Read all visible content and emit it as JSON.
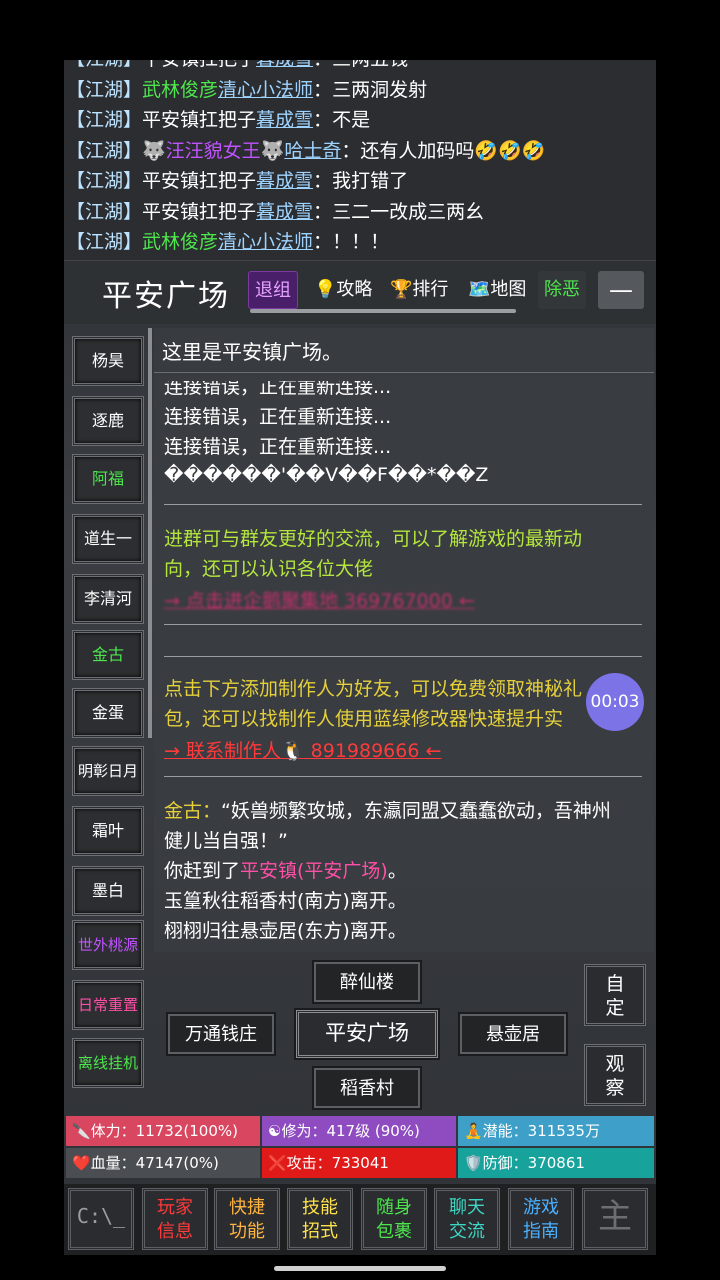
{
  "chat": {
    "lines": [
      {
        "channel": "【江湖】",
        "title": "平安镇扛把子",
        "name": "暮成雪",
        "sep": "：",
        "msg": "三两五钱"
      },
      {
        "channel": "【江湖】",
        "title": "武林俊彦",
        "name": "清心小法师",
        "sep": "：",
        "msg": "三两洞发射"
      },
      {
        "channel": "【江湖】",
        "title": "平安镇扛把子",
        "name": "暮成雪",
        "sep": "：",
        "msg": "不是"
      },
      {
        "channel": "【江湖】",
        "title": "🐺汪汪貌女王🐺",
        "name": "哈士奇",
        "sep": "：",
        "msg": "还有人加码吗",
        "emoji": "🤣🤣🤣"
      },
      {
        "channel": "【江湖】",
        "title": "平安镇扛把子",
        "name": "暮成雪",
        "sep": "：",
        "msg": "我打错了"
      },
      {
        "channel": "【江湖】",
        "title": "平安镇扛把子",
        "name": "暮成雪",
        "sep": "：",
        "msg": "三二一改成三两幺"
      },
      {
        "channel": "【江湖】",
        "title": "武林俊彦",
        "name": "清心小法师",
        "sep": "：",
        "msg": "！！！"
      }
    ]
  },
  "header": {
    "location": "平安广场",
    "quit": "退组",
    "guide": "💡攻略",
    "rank": "🏆排行",
    "map": "🗺️地图",
    "evil": "除恶",
    "minimize": "—"
  },
  "players": [
    {
      "name": "杨昊",
      "color": "white"
    },
    {
      "name": "逐鹿",
      "color": "white"
    },
    {
      "name": "阿福",
      "color": "green"
    },
    {
      "name": "道生一",
      "color": "white"
    },
    {
      "name": "李清河",
      "color": "white"
    },
    {
      "name": "金古",
      "color": "green"
    },
    {
      "name": "金蛋",
      "color": "white"
    },
    {
      "name": "明彰日月",
      "color": "white"
    },
    {
      "name": "霜叶",
      "color": "white"
    },
    {
      "name": "墨白",
      "color": "white"
    },
    {
      "name": "世外桃源",
      "color": "purple"
    },
    {
      "name": "日常重置",
      "color": "pink"
    },
    {
      "name": "离线挂机",
      "color": "green"
    }
  ],
  "panel": {
    "room_desc": "这里是平安镇广场。",
    "log": [
      "连接错误，正在重新连接...",
      "连接错误，正在重新连接...",
      "连接错误，正在重新连接...",
      "������'��V��F��*��Z"
    ],
    "group_text_1": "进群可与群友更好的交流，可以了解游戏的最新动",
    "group_text_2": "向，还可以认识各位大佬",
    "group_link": "→ 点击进企鹅聚集地 369767000 ←",
    "friend_text_1": "点击下方添加制作人为好友，可以免费领取神秘礼",
    "friend_text_2": "包，还可以找制作人使用蓝绿修改器快速提升实",
    "friend_link": "→ 联系制作人🐧 891989666 ←",
    "quote_speaker": "金古：",
    "quote_1": "“妖兽频繁攻城，东瀛同盟又蠢蠢欲动，吾神州",
    "quote_2": "健儿当自强！”",
    "arrive_pre": "你赶到了",
    "arrive_place": "平安镇(平安广场)",
    "arrive_post": "。",
    "leave_1": "玉篁秋往稻香村(南方)离开。",
    "leave_2": "栩栩归往悬壶居(东方)离开。"
  },
  "timer": "00:03",
  "directions": {
    "north": "醉仙楼",
    "west": "万通钱庄",
    "center": "平安广场",
    "east": "悬壶居",
    "south": "稻香村"
  },
  "side_buttons": {
    "custom_1": "自",
    "custom_2": "定",
    "observe_1": "观",
    "observe_2": "察"
  },
  "stats": {
    "stamina": "🔪体力：11732(100%)",
    "cultivation": "☯修为：417级 (90%)",
    "potential": "🧘潜能：311535万",
    "blood": "❤️血量：47147(0%)",
    "attack": "❌攻击：733041",
    "defense": "🛡️防御：370861"
  },
  "menu": {
    "cmd": "C:\\_",
    "info_1": "玩家",
    "info_2": "信息",
    "quick_1": "快捷",
    "quick_2": "功能",
    "skill_1": "技能",
    "skill_2": "招式",
    "bag_1": "随身",
    "bag_2": "包裹",
    "chat_1": "聊天",
    "chat_2": "交流",
    "guide_1": "游戏",
    "guide_2": "指南",
    "zhu": "主"
  }
}
